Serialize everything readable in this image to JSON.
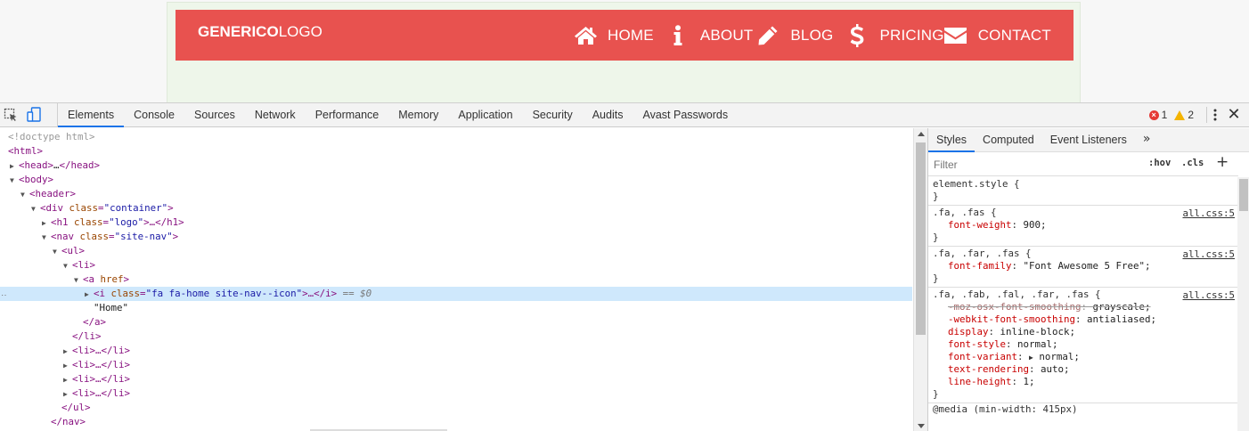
{
  "site": {
    "logo_bold": "GENERICO",
    "logo_thin": "LOGO",
    "nav": [
      {
        "label": "HOME",
        "icon": "home-icon"
      },
      {
        "label": "ABOUT",
        "icon": "info-icon"
      },
      {
        "label": "BLOG",
        "icon": "pencil-icon"
      },
      {
        "label": "PRICING",
        "icon": "dollar-icon"
      },
      {
        "label": "CONTACT",
        "icon": "envelope-icon"
      }
    ],
    "colors": {
      "header_bg": "#e8524f",
      "page_bg": "#eef6ea"
    }
  },
  "devtools": {
    "tabs": [
      "Elements",
      "Console",
      "Sources",
      "Network",
      "Performance",
      "Memory",
      "Application",
      "Security",
      "Audits",
      "Avast Passwords"
    ],
    "active_tab": "Elements",
    "error_count": "1",
    "warning_count": "2",
    "dom": {
      "doctype": "<!doctype html>",
      "html": "<html>",
      "head_open": "<head>",
      "head_ellipsis": "…",
      "head_close": "</head>",
      "body": "<body>",
      "header": "<header>",
      "div_tag": "<div",
      "div_attr": "class",
      "div_val": "\"container\"",
      "h1_tag": "<h1",
      "h1_attr": "class",
      "h1_val": "\"logo\"",
      "h1_rest": ">…</h1>",
      "nav_tag": "<nav",
      "nav_attr": "class",
      "nav_val": "\"site-nav\"",
      "ul": "<ul>",
      "li": "<li>",
      "a_tag": "<a",
      "a_attr": "href",
      "i_tag": "<i",
      "i_attr": "class",
      "i_val": "\"fa fa-home site-nav--icon\"",
      "i_rest": ">…</i>",
      "i_eq": " == $0",
      "text_node": "\"Home\"",
      "a_close": "</a>",
      "li_close": "</li>",
      "li_collapsed": "<li>…</li>",
      "ul_close": "</ul>",
      "nav_close": "</nav>"
    },
    "styles": {
      "tabs": [
        "Styles",
        "Computed",
        "Event Listeners"
      ],
      "more": "»",
      "filter_placeholder": "Filter",
      "hov": ":hov",
      "cls": ".cls",
      "plus": "+",
      "rules": [
        {
          "selector": "element.style {",
          "source": "",
          "props": [],
          "close": "}"
        },
        {
          "selector": ".fa, .fas {",
          "source": "all.css:5",
          "props": [
            {
              "name": "font-weight",
              "value": "900;",
              "struck": false
            }
          ],
          "close": "}"
        },
        {
          "selector": ".fa, .far, .fas {",
          "source": "all.css:5",
          "props": [
            {
              "name": "font-family",
              "value": "\"Font Awesome 5 Free\";",
              "struck": false
            }
          ],
          "close": "}"
        },
        {
          "selector": ".fa, .fab, .fal, .far, .fas {",
          "source": "all.css:5",
          "props": [
            {
              "name": "-moz-osx-font-smoothing",
              "value": "grayscale;",
              "struck": true
            },
            {
              "name": "-webkit-font-smoothing",
              "value": "antialiased;",
              "struck": false
            },
            {
              "name": "display",
              "value": "inline-block;",
              "struck": false
            },
            {
              "name": "font-style",
              "value": "normal;",
              "struck": false
            },
            {
              "name": "font-variant",
              "value": "normal;",
              "struck": false,
              "expand": true
            },
            {
              "name": "text-rendering",
              "value": "auto;",
              "struck": false
            },
            {
              "name": "line-height",
              "value": "1;",
              "struck": false
            }
          ],
          "close": "}"
        }
      ],
      "media": "@media (min-width: 415px)"
    }
  }
}
